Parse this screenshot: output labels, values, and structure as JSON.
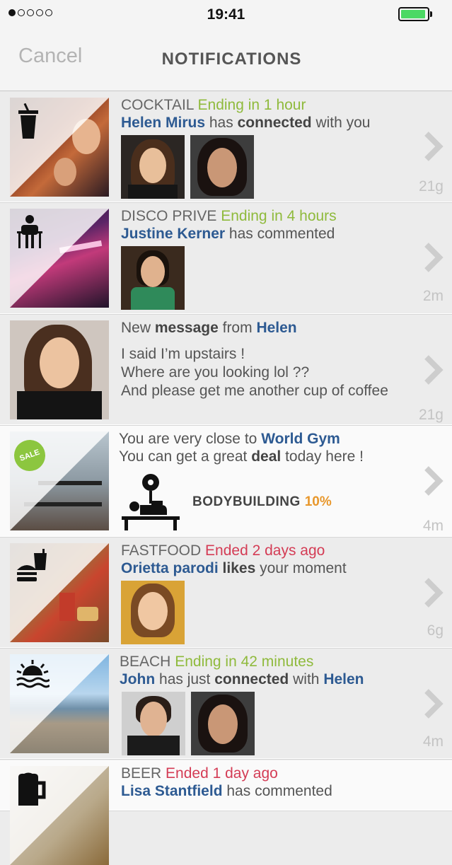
{
  "status_bar": {
    "time": "19:41",
    "signal_dots_filled": 1,
    "signal_dots_total": 5,
    "battery_level": 0.95
  },
  "nav": {
    "cancel_label": "Cancel",
    "title": "NOTIFICATIONS"
  },
  "notifications": [
    {
      "category": "COCKTAIL",
      "status": "Ending in 1 hour",
      "user": "Helen Mirus",
      "text_before": "has",
      "action": "connected",
      "text_after": "with you",
      "icon": "cocktail-glass-icon",
      "time": "21g"
    },
    {
      "category": "DISCO PRIVE",
      "status": "Ending in 4 hours",
      "user": "Justine Kerner",
      "text_after": "has commented",
      "icon": "bouncer-icon",
      "time": "2m"
    },
    {
      "prefix": "New",
      "action": "message",
      "middle": "from",
      "user": "Helen",
      "message_lines": [
        "I said I’m upstairs !",
        "Where are you looking lol ??",
        "And please get me another cup of coffee"
      ],
      "time": "21g"
    },
    {
      "line1_prefix": "You are very close to",
      "place": "World Gym",
      "line2_prefix": "You can get a great",
      "deal": "deal",
      "line2_suffix": "today here !",
      "sale_badge": "SALE",
      "offer_label": "BODYBUILDING",
      "offer_value": "10%",
      "icon": "weightlifter-icon",
      "time": "4m"
    },
    {
      "category": "FASTFOOD",
      "status": "Ended 2 days ago",
      "user": "Orietta parodi",
      "action": "likes",
      "text_after": "your moment",
      "icon": "burger-drink-icon",
      "time": "6g"
    },
    {
      "category": "BEACH",
      "status": "Ending in 42 minutes",
      "user": "John",
      "text_before": "has just",
      "action": "connected",
      "text_after": "with",
      "user2": "Helen",
      "icon": "sunset-sea-icon",
      "time": "4m"
    },
    {
      "category": "BEER",
      "status": "Ended 1 day ago",
      "user": "Lisa Stantfield",
      "text_after": "has commented",
      "icon": "beer-mug-icon"
    }
  ],
  "colors": {
    "green_status": "#8fba3c",
    "red_status": "#d43c55",
    "name_blue": "#2d5a92",
    "offer_orange": "#e8972b",
    "sale_green": "#8cc63f"
  }
}
